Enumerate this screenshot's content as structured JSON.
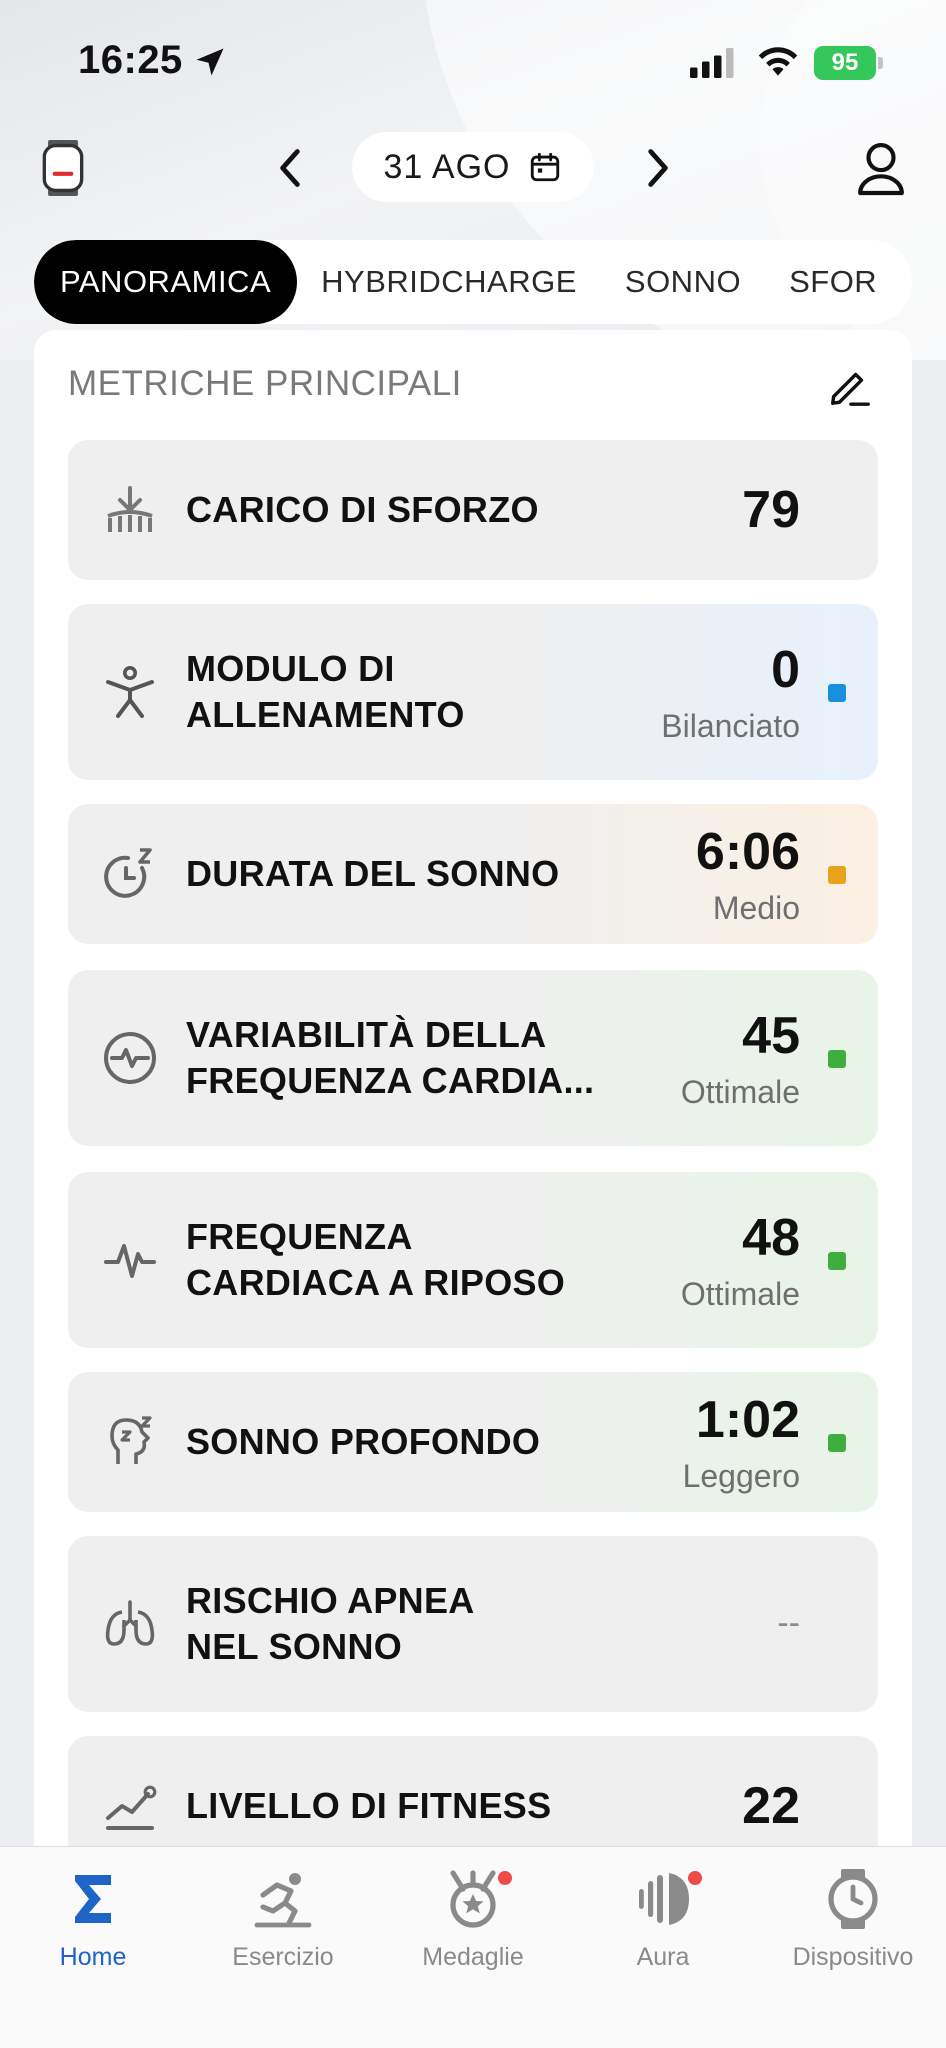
{
  "status_bar": {
    "time": "16:25",
    "battery": "95"
  },
  "header": {
    "date": "31 AGO"
  },
  "tabs": [
    {
      "label": "PANORAMICA",
      "active": true
    },
    {
      "label": "HYBRIDCHARGE",
      "active": false
    },
    {
      "label": "SONNO",
      "active": false
    },
    {
      "label": "SFOR",
      "active": false
    }
  ],
  "section": {
    "title": "METRICHE PRINCIPALI"
  },
  "metrics": [
    {
      "label": "CARICO DI SFORZO",
      "value": "79",
      "status": "",
      "status_color": ""
    },
    {
      "label_line1": "MODULO DI",
      "label_line2": "ALLENAMENTO",
      "value": "0",
      "status": "Bilanciato",
      "status_color": "#1a8fe0"
    },
    {
      "label": "DURATA DEL SONNO",
      "value": "6:06",
      "status": "Medio",
      "status_color": "#e8a21c"
    },
    {
      "label_line1": "VARIABILITÀ DELLA",
      "label_line2": "FREQUENZA CARDIA...",
      "value": "45",
      "status": "Ottimale",
      "status_color": "#3fae3f"
    },
    {
      "label_line1": "FREQUENZA",
      "label_line2": "CARDIACA A RIPOSO",
      "value": "48",
      "status": "Ottimale",
      "status_color": "#3fae3f"
    },
    {
      "label": "SONNO PROFONDO",
      "value": "1:02",
      "status": "Leggero",
      "status_color": "#3fae3f"
    },
    {
      "label_line1": "RISCHIO APNEA",
      "label_line2": "NEL SONNO",
      "value": "--",
      "status": "",
      "status_color": ""
    },
    {
      "label": "LIVELLO DI FITNESS",
      "value": "22",
      "status": "",
      "status_color": ""
    }
  ],
  "bottom_nav": [
    {
      "label": "Home",
      "icon": "sigma-icon",
      "active": true
    },
    {
      "label": "Esercizio",
      "icon": "exercise-icon",
      "active": false
    },
    {
      "label": "Medaglie",
      "icon": "medal-icon",
      "active": false,
      "badge": true
    },
    {
      "label": "Aura",
      "icon": "aura-icon",
      "active": false,
      "badge": true
    },
    {
      "label": "Dispositivo",
      "icon": "watch-icon",
      "active": false
    }
  ],
  "colors": {
    "accent": "#1f64c7",
    "badge": "#ef4a4a",
    "battery": "#34c759"
  }
}
